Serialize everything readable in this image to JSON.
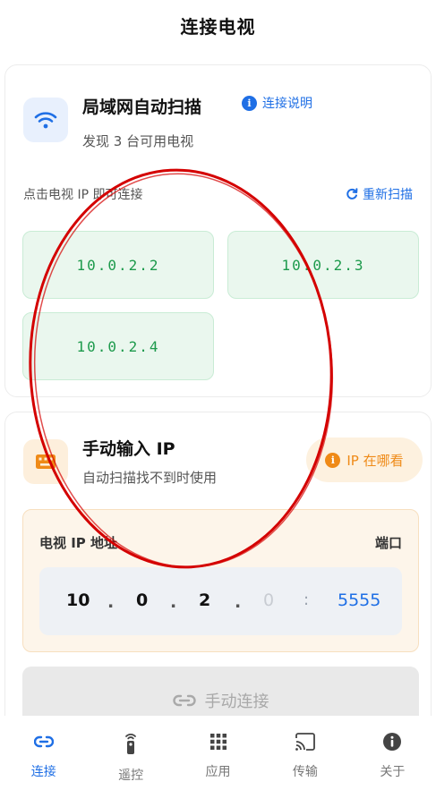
{
  "header": {
    "title": "连接电视"
  },
  "scan": {
    "title": "局域网自动扫描",
    "subtitle": "发现 3 台可用电视",
    "help_link": "连接说明",
    "hint": "点击电视 IP 即可连接",
    "rescan": "重新扫描",
    "devices": [
      {
        "ip": "10.0.2.2"
      },
      {
        "ip": "10.0.2.3"
      },
      {
        "ip": "10.0.2.4"
      }
    ]
  },
  "manual": {
    "title": "手动输入 IP",
    "subtitle": "自动扫描找不到时使用",
    "where_pill": "IP 在哪看",
    "ip_label": "电视 IP 地址",
    "port_label": "端口",
    "segments": [
      "10",
      "0",
      "2",
      "0"
    ],
    "dot": ".",
    "colon": ":",
    "port": "5555",
    "connect_button": "手动连接"
  },
  "tabs": [
    {
      "label": "连接",
      "icon": "link-icon",
      "active": true
    },
    {
      "label": "遥控",
      "icon": "remote-icon",
      "active": false
    },
    {
      "label": "应用",
      "icon": "apps-grid-icon",
      "active": false
    },
    {
      "label": "传输",
      "icon": "cast-icon",
      "active": false
    },
    {
      "label": "关于",
      "icon": "info-icon",
      "active": false
    }
  ],
  "colors": {
    "accent": "#1f6fe5",
    "success": "#1d9a4c",
    "warning": "#ef8a17",
    "annotation": "#d40000"
  }
}
